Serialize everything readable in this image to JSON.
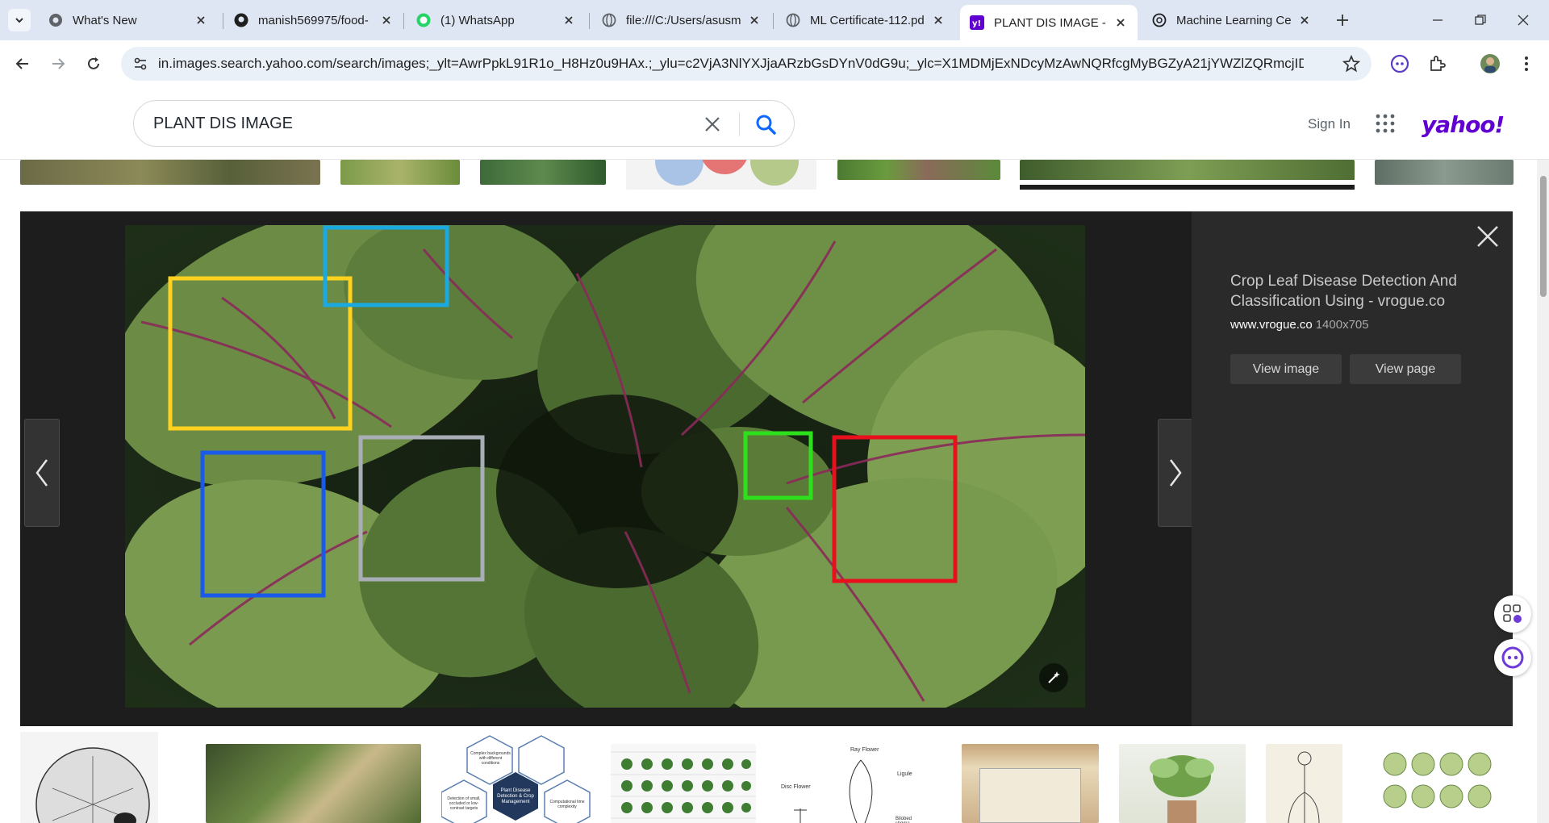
{
  "browser": {
    "tabs": [
      {
        "title": "What's New",
        "icon": "chrome-icon"
      },
      {
        "title": "manish569975/food-",
        "icon": "github-icon"
      },
      {
        "title": "(1) WhatsApp",
        "icon": "whatsapp-icon"
      },
      {
        "title": "file:///C:/Users/asusm",
        "icon": "globe-icon"
      },
      {
        "title": "ML Certificate-112.pd",
        "icon": "globe-icon"
      },
      {
        "title": "PLANT DIS IMAGE - Y",
        "icon": "yahoo-icon",
        "active": true
      },
      {
        "title": "Machine Learning Ce",
        "icon": "openai-icon"
      }
    ],
    "url": "in.images.search.yahoo.com/search/images;_ylt=AwrPpkL91R1o_H8Hz0u9HAx.;_ylu=c2VjA3NlYXJjaARzbGsDYnV0dG9u;_ylc=X1MDMjExNDcyMzAwNQRfcgMyBGZyA21jYWZlZQRmcjIDcD..."
  },
  "yahoo": {
    "search_value": "PLANT DIS IMAGE",
    "sign_in": "Sign In",
    "logo": "yahoo!"
  },
  "lightbox": {
    "title": "Crop Leaf Disease Detection And Classification Using - vrogue.co",
    "source": "www.vrogue.co",
    "dimensions": "1400x705",
    "view_image": "View image",
    "view_page": "View page"
  },
  "colors": {
    "yahoo_purple": "#6001d2",
    "box_yellow": "#ffd21f",
    "box_cyan": "#1aa9e0",
    "box_blue": "#1a5ae8",
    "box_gray": "#a9aeb6",
    "box_green": "#2ee01c",
    "box_red": "#e8101c"
  },
  "thumb_texts": {
    "flower_label_1": "Ray Flower",
    "flower_label_2": "Ligule",
    "flower_label_3": "Disc Flower",
    "flower_label_4": "Bilobed stigma",
    "hex_center": "Plant Disease Detection & Crop Management",
    "hex_1": "Complex backgrounds with different conditions",
    "hex_2": "Detection of small, occluded or low-contrast targets",
    "hex_3": "Computational time complexity"
  }
}
